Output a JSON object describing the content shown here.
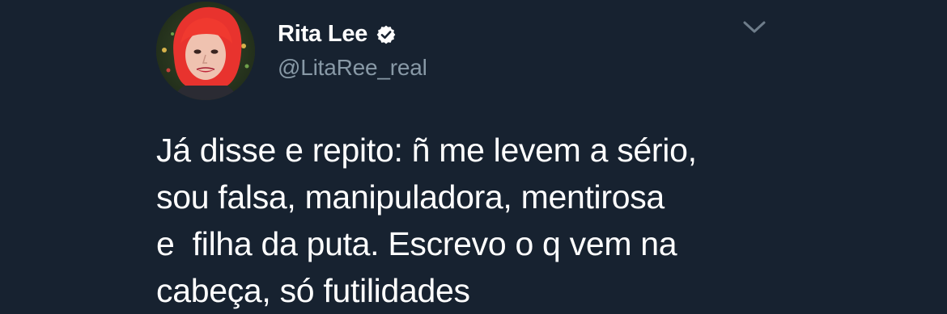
{
  "tweet": {
    "author": {
      "display_name": "Rita Lee",
      "handle": "@LitaRee_real",
      "verified": true,
      "avatar_icon": "avatar-photo"
    },
    "text_lines": [
      "Já disse e repito: ñ me levem a sério,",
      "sou falsa, manipuladora, mentirosa",
      "e  filha da puta. Escrevo o q vem na",
      "cabeça, só futilidades"
    ],
    "menu_icon": "chevron-down-icon"
  },
  "colors": {
    "background": "#172230",
    "text": "#ffffff",
    "handle": "#8899a6",
    "verified_badge": "#ffffff"
  }
}
